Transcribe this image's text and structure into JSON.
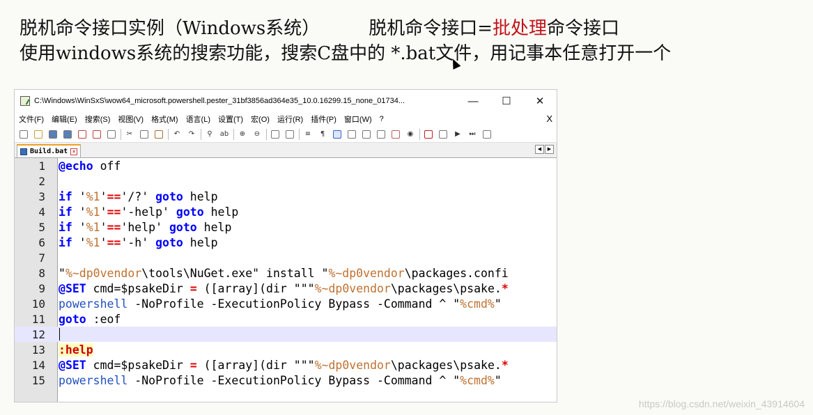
{
  "slide": {
    "line1_part1": "脱机命令接口实例（Windows系统）",
    "line1_part2": "脱机命令接口=",
    "line1_red": "批处理",
    "line1_part3": "命令接口",
    "line2": "使用windows系统的搜索功能，搜索C盘中的 *.bat文件，用记事本任意打开一个"
  },
  "window": {
    "title": "C:\\Windows\\WinSxS\\wow64_microsoft.powershell.pester_31bf3856ad364e35_10.0.16299.15_none_01734...",
    "minimize": "—",
    "maximize": "☐",
    "close": "✕"
  },
  "menu": {
    "items": [
      "文件(F)",
      "编辑(E)",
      "搜索(S)",
      "视图(V)",
      "格式(M)",
      "语言(L)",
      "设置(T)",
      "宏(O)",
      "运行(R)",
      "插件(P)",
      "窗口(W)",
      "?"
    ],
    "close": "X"
  },
  "tab": {
    "label": "Build.bat"
  },
  "editor": {
    "lines": [
      {
        "n": "1"
      },
      {
        "n": "2"
      },
      {
        "n": "3"
      },
      {
        "n": "4"
      },
      {
        "n": "5"
      },
      {
        "n": "6"
      },
      {
        "n": "7"
      },
      {
        "n": "8"
      },
      {
        "n": "9"
      },
      {
        "n": "10"
      },
      {
        "n": "11"
      },
      {
        "n": "12"
      },
      {
        "n": "13"
      },
      {
        "n": "14"
      },
      {
        "n": "15"
      }
    ],
    "l1": {
      "a": "@",
      "b": "echo",
      "c": " off"
    },
    "l3": {
      "a": "if",
      "b": " '",
      "c": "%1",
      "d": "'",
      "e": "==",
      "f": "'/?' ",
      "g": "goto",
      "h": " help"
    },
    "l4": {
      "a": "if",
      "b": " '",
      "c": "%1",
      "d": "'",
      "e": "==",
      "f": "'-help' ",
      "g": "goto",
      "h": " help"
    },
    "l5": {
      "a": "if",
      "b": " '",
      "c": "%1",
      "d": "'",
      "e": "==",
      "f": "'help' ",
      "g": "goto",
      "h": " help"
    },
    "l6": {
      "a": "if",
      "b": " '",
      "c": "%1",
      "d": "'",
      "e": "==",
      "f": "'-h' ",
      "g": "goto",
      "h": " help"
    },
    "l8": {
      "a": "\"",
      "b": "%~dp0vendor",
      "c": "\\tools\\NuGet.exe\" install \"",
      "d": "%~dp0vendor",
      "e": "\\packages.confi"
    },
    "l9": {
      "a": "@",
      "b": "SET",
      "c": " cmd=$psakeDir ",
      "d": "=",
      "e": " ([array](dir \"\"\"",
      "f": "%~dp0vendor",
      "g": "\\packages\\psake.",
      "h": "*"
    },
    "l10": {
      "a": "powershell",
      "b": " -NoProfile -ExecutionPolicy Bypass -Command ^ \"",
      "c": "%cmd%",
      "d": "\""
    },
    "l11": {
      "a": "goto",
      "b": " :eof"
    },
    "l13": {
      "a": ":help"
    },
    "l14": {
      "a": "@",
      "b": "SET",
      "c": " cmd=$psakeDir ",
      "d": "=",
      "e": " ([array](dir \"\"\"",
      "f": "%~dp0vendor",
      "g": "\\packages\\psake.",
      "h": "*"
    },
    "l15": {
      "a": "powershell",
      "b": " -NoProfile -ExecutionPolicy Bypass -Command ^ \"",
      "c": "%cmd%",
      "d": "\""
    }
  },
  "watermark": "https://blog.csdn.net/weixin_43914604"
}
